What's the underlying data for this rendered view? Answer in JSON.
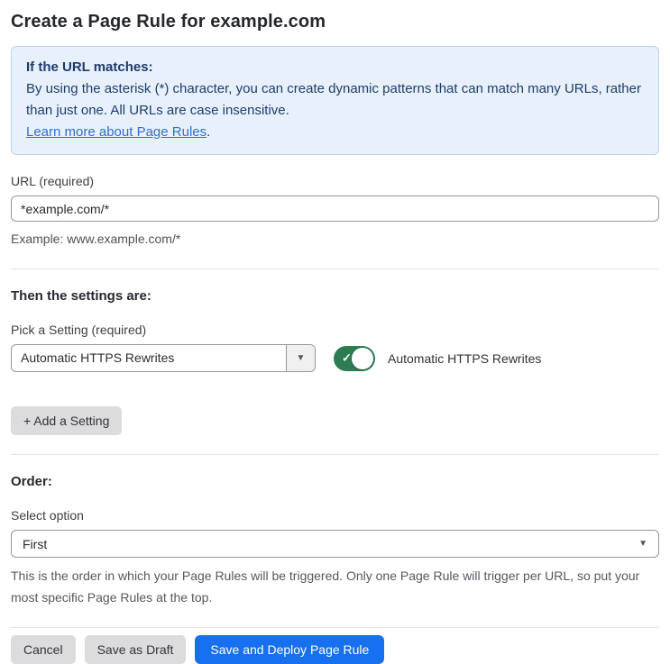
{
  "page": {
    "title": "Create a Page Rule for example.com"
  },
  "info_box": {
    "heading": "If the URL matches:",
    "body": "By using the asterisk (*) character, you can create dynamic patterns that can match many URLs, rather than just one. All URLs are case insensitive.",
    "link_label": "Learn more about Page Rules",
    "link_suffix": "."
  },
  "url_field": {
    "label": "URL (required)",
    "value": "*example.com/*",
    "helper": "Example: www.example.com/*"
  },
  "settings_section": {
    "heading": "Then the settings are:",
    "picker_label": "Pick a Setting (required)",
    "picker_selected": "Automatic HTTPS Rewrites",
    "picker_caret": "▼",
    "toggle_state": "on",
    "toggle_check": "✓",
    "toggle_label": "Automatic HTTPS Rewrites",
    "add_button_label": "+ Add a Setting"
  },
  "order_section": {
    "heading": "Order:",
    "select_label": "Select option",
    "select_value": "First",
    "select_caret": "▼",
    "helper": "This is the order in which your Page Rules will be triggered. Only one Page Rule will trigger per URL, so put your most specific Page Rules at the top."
  },
  "footer": {
    "cancel_label": "Cancel",
    "save_draft_label": "Save as Draft",
    "save_deploy_label": "Save and Deploy Page Rule"
  },
  "colors": {
    "info_bg": "#e8f1fb",
    "info_border": "#b9d3f0",
    "info_text": "#1d3c6e",
    "link_blue": "#2f6fd3",
    "toggle_green": "#2e7c52",
    "primary_button_blue": "#1670f0",
    "gray_button_bg": "#dcdcdf",
    "input_border": "#94969a",
    "divider": "#e4e5e8"
  }
}
